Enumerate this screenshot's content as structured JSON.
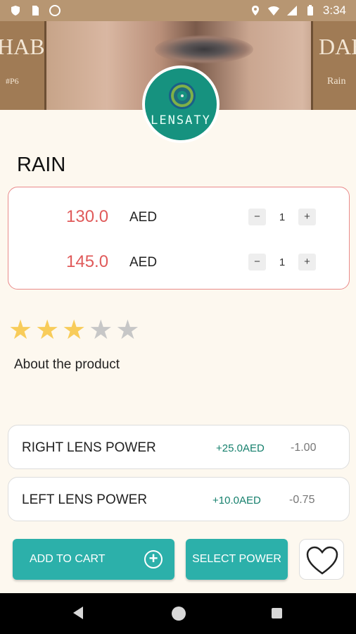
{
  "status_bar": {
    "time": "3:34",
    "left_icons": [
      "shield-icon",
      "sim-card-icon",
      "circle-icon"
    ],
    "right_icons": [
      "location-icon",
      "wifi-icon",
      "signal-icon",
      "battery-icon"
    ],
    "background": "#b79672"
  },
  "banner": {
    "left_brand": "HAB",
    "left_sub": "#P6",
    "right_brand": "DAH",
    "right_sub": "Rain"
  },
  "logo": {
    "text": "LENSATY",
    "color": "#16927f"
  },
  "product": {
    "title": "RAIN"
  },
  "prices": [
    {
      "amount": "130.0",
      "currency": "AED",
      "quantity": "1",
      "minus": "−",
      "plus": "+"
    },
    {
      "amount": "145.0",
      "currency": "AED",
      "quantity": "1",
      "minus": "−",
      "plus": "+"
    }
  ],
  "rating": {
    "value": 3,
    "max": 5,
    "on_color": "#f8cc5a",
    "off_color": "#c7c7c7"
  },
  "about_label": "About the product",
  "lens_power": [
    {
      "label": "RIGHT LENS POWER",
      "extra": "+25.0AED",
      "value": "-1.00"
    },
    {
      "label": "LEFT LENS POWER",
      "extra": "+10.0AED",
      "value": "-0.75"
    }
  ],
  "actions": {
    "add_to_cart": "ADD TO CART",
    "select_power": "SELECT POWER",
    "accent": "#2cb0aa"
  },
  "nav_bar": {
    "icons": [
      "back-icon",
      "home-icon",
      "recents-icon"
    ]
  }
}
